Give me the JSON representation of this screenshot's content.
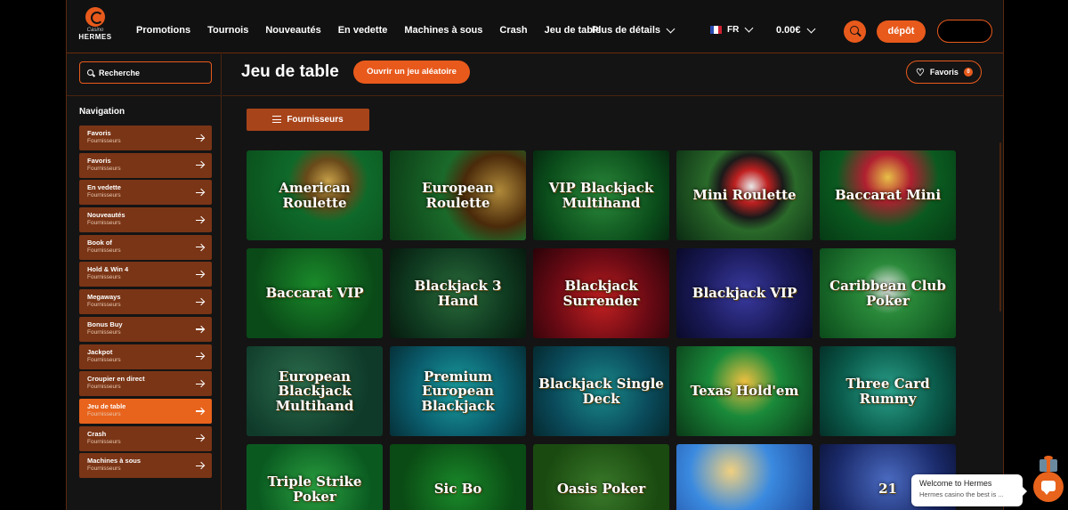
{
  "brand": {
    "script": "Casino",
    "name": "HERMES"
  },
  "nav": {
    "items": [
      "Promotions",
      "Tournois",
      "Nouveautés",
      "En vedette",
      "Machines à sous",
      "Crash",
      "Jeu de table"
    ],
    "more": "Plus de détails"
  },
  "header": {
    "language": "FR",
    "balance": "0.00€",
    "deposit_label": "dépôt"
  },
  "sidebar": {
    "search_placeholder": "Recherche",
    "nav_title": "Navigation",
    "items": [
      {
        "label": "Favoris",
        "sub": "Fournisseurs"
      },
      {
        "label": "Favoris",
        "sub": "Fournisseurs"
      },
      {
        "label": "En vedette",
        "sub": "Fournisseurs"
      },
      {
        "label": "Nouveautés",
        "sub": "Fournisseurs"
      },
      {
        "label": "Book of",
        "sub": "Fournisseurs"
      },
      {
        "label": "Hold & Win 4",
        "sub": "Fournisseurs"
      },
      {
        "label": "Megaways",
        "sub": "Fournisseurs"
      },
      {
        "label": "Bonus Buy",
        "sub": "Fournisseurs"
      },
      {
        "label": "Jackpot",
        "sub": "Fournisseurs"
      },
      {
        "label": "Croupier en direct",
        "sub": "Fournisseurs"
      },
      {
        "label": "Jeu de table",
        "sub": "Fournisseurs"
      },
      {
        "label": "Crash",
        "sub": "Fournisseurs"
      },
      {
        "label": "Machines à sous",
        "sub": "Fournisseurs"
      }
    ],
    "active_index": 10
  },
  "main": {
    "title": "Jeu de table",
    "random_label": "Ouvrir un jeu aléatoire",
    "favorites_label": "Favoris",
    "favorites_count": "0",
    "providers_label": "Fournisseurs"
  },
  "games": [
    "American Roulette",
    "European Roulette",
    "VIP Blackjack Multihand",
    "Mini Roulette",
    "Baccarat Mini",
    "Baccarat VIP",
    "Blackjack 3 Hand",
    "Blackjack Surrender",
    "Blackjack VIP",
    "Caribbean Club Poker",
    "European Blackjack Multihand",
    "Premium European Blackjack",
    "Blackjack Single Deck",
    "Texas Hold'em",
    "Three Card Rummy",
    "Triple Strike Poker",
    "Sic Bo",
    "Oasis Poker",
    "",
    "21"
  ],
  "chat": {
    "title": "Welcome to Hermes",
    "subtitle": "Hermes casino the best is ..."
  },
  "colors": {
    "accent": "#e85a1c",
    "sidebar_item": "#7a3516",
    "background": "#141414"
  }
}
